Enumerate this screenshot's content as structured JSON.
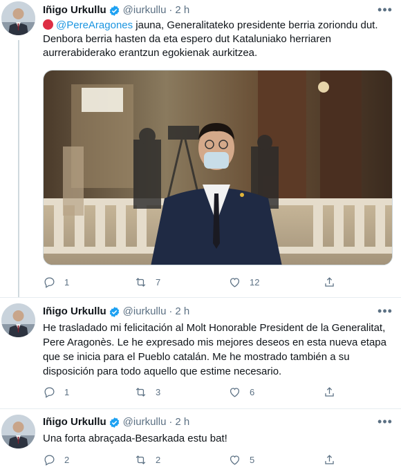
{
  "tweets": [
    {
      "author_name": "Iñigo Urkullu",
      "handle": "@iurkullu",
      "separator": "·",
      "time": "2 h",
      "mention": "@PereAragones",
      "text_after_mention": " jauna, Generalitateko presidente berria zoriondu dut.",
      "text_line2": "Denbora berria hasten da eta espero dut  Kataluniako herriaren",
      "text_line3": "aurrerabiderako erantzun egokienak aurkitzea.",
      "replies": "1",
      "retweets": "7",
      "likes": "12"
    },
    {
      "author_name": "Iñigo Urkullu",
      "handle": "@iurkullu",
      "separator": "·",
      "time": "2 h",
      "text_line1": "He trasladado mi felicitación al Molt Honorable President de la Generalitat,",
      "text_line2": "Pere Aragonès. Le he expresado mis mejores deseos en esta nueva etapa",
      "text_line3": "que se inicia para el Pueblo catalán. Me he mostrado también a su",
      "text_line4": "disposición para todo aquello que estime necesario.",
      "replies": "1",
      "retweets": "3",
      "likes": "6"
    },
    {
      "author_name": "Iñigo Urkullu",
      "handle": "@iurkullu",
      "separator": "·",
      "time": "2 h",
      "text_line1": "Una forta abraçada-Besarkada estu bat!",
      "replies": "2",
      "retweets": "2",
      "likes": "5"
    }
  ],
  "icons": {
    "more": "more-horizontal-icon",
    "reply": "reply-icon",
    "retweet": "retweet-icon",
    "like": "heart-icon",
    "share": "share-icon",
    "verified": "verified-badge-icon",
    "flag": "red-circle-emoji"
  },
  "colors": {
    "link": "#1b95e0",
    "secondary_text": "#5b7083",
    "verified": "#1da1f2",
    "divider": "#e6ecf0"
  }
}
